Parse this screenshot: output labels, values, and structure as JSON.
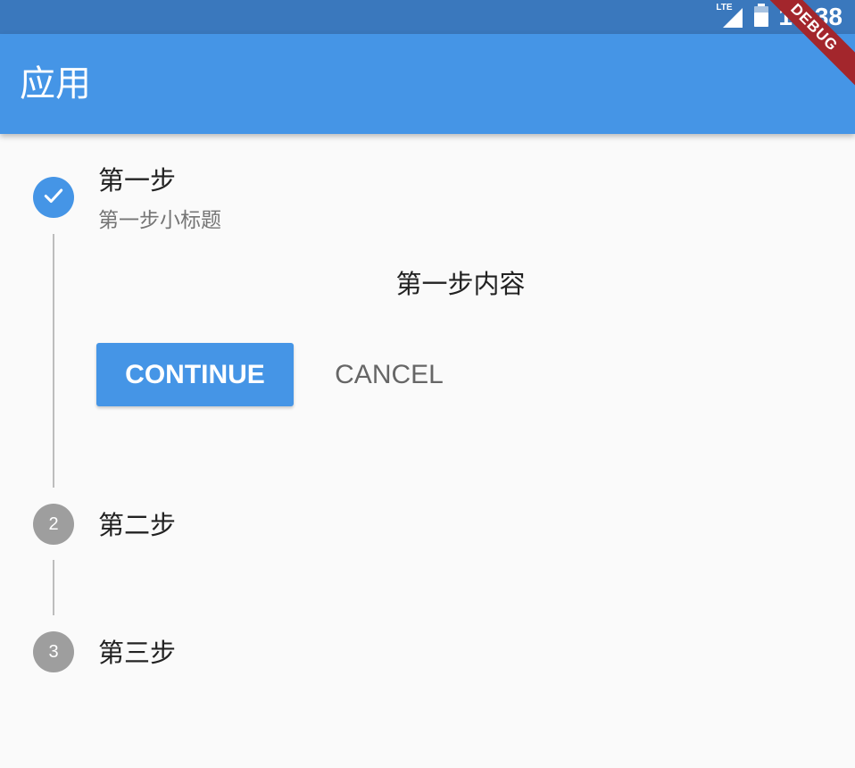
{
  "status_bar": {
    "network": "LTE",
    "time": "16:38",
    "color": "#3a78bd"
  },
  "app_bar": {
    "title": "应用",
    "color": "#4595e6"
  },
  "debug_banner": "DEBUG",
  "stepper": {
    "steps": [
      {
        "title": "第一步",
        "subtitle": "第一步小标题",
        "content": "第一步内容",
        "state": "complete",
        "icon": "check-icon"
      },
      {
        "title": "第二步",
        "number": "2",
        "state": "inactive"
      },
      {
        "title": "第三步",
        "number": "3",
        "state": "inactive"
      }
    ],
    "controls": {
      "continue_label": "CONTINUE",
      "cancel_label": "CANCEL"
    },
    "active_color": "#4595e6",
    "inactive_color": "#9e9e9e"
  }
}
